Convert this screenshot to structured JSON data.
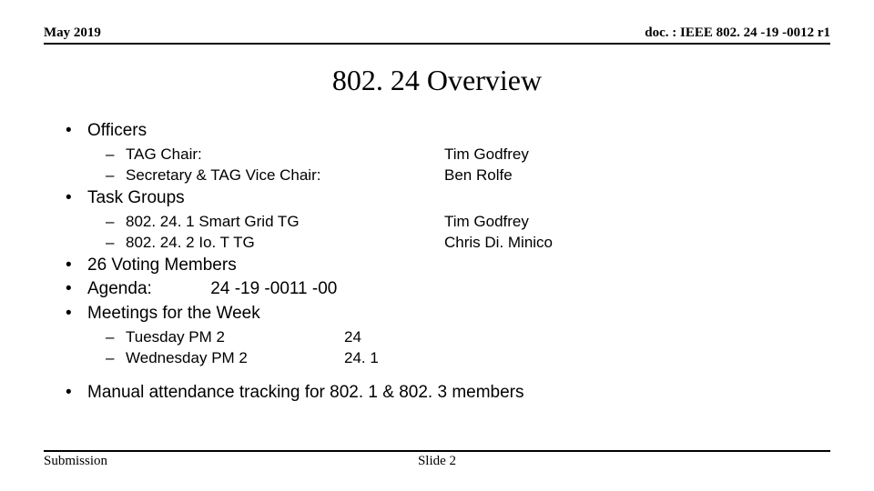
{
  "header": {
    "date": "May 2019",
    "doc": "doc. : IEEE 802. 24 -19 -0012 r1"
  },
  "title": "802. 24 Overview",
  "content": {
    "officers_label": "Officers",
    "officers": [
      {
        "role": "TAG Chair:",
        "name": "Tim Godfrey"
      },
      {
        "role": "Secretary & TAG Vice Chair:",
        "name": "Ben Rolfe"
      }
    ],
    "task_groups_label": "Task Groups",
    "task_groups": [
      {
        "group": "802. 24. 1 Smart Grid TG",
        "lead": "Tim Godfrey"
      },
      {
        "group": "802. 24. 2 Io. T TG",
        "lead": "Chris Di. Minico"
      }
    ],
    "voting_members": "26 Voting Members",
    "agenda_label": "Agenda:",
    "agenda_doc": "24 -19 -0011 -00",
    "meetings_label": "Meetings for the Week",
    "meetings": [
      {
        "slot": "Tuesday PM 2",
        "group": "24"
      },
      {
        "slot": "Wednesday PM 2",
        "group": "24. 1"
      }
    ],
    "attendance_note": "Manual attendance tracking for 802. 1 & 802. 3 members"
  },
  "footer": {
    "left": "Submission",
    "center": "Slide 2"
  }
}
